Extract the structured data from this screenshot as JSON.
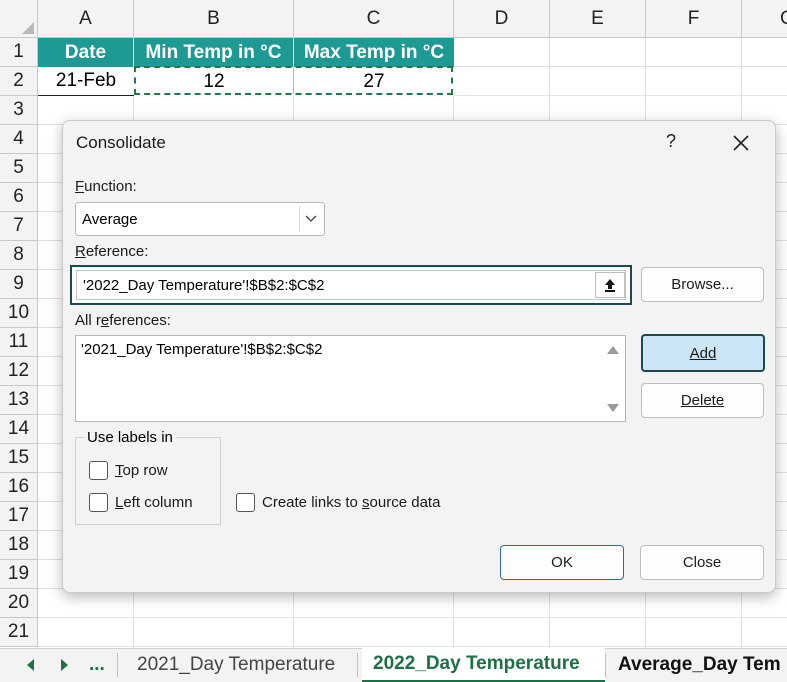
{
  "columns": [
    "A",
    "B",
    "C",
    "D",
    "E",
    "F",
    "G"
  ],
  "rows": [
    "1",
    "2",
    "3",
    "4",
    "5",
    "6",
    "7",
    "8",
    "9",
    "10",
    "11",
    "12",
    "13",
    "14",
    "15",
    "16",
    "17",
    "18",
    "19",
    "20",
    "21"
  ],
  "table": {
    "headers": [
      "Date",
      "Min Temp in °C",
      "Max Temp in °C"
    ],
    "values": [
      "21-Feb",
      "12",
      "27"
    ]
  },
  "colors": {
    "header_fill": "#1d9a94",
    "active_tab": "#1e7145",
    "marquee": "#1f7a4a"
  },
  "dialog": {
    "title": "Consolidate",
    "help": "?",
    "function_label_u": "F",
    "function_label_rest": "unction:",
    "function_value": "Average",
    "reference_label_u": "R",
    "reference_label_rest": "eference:",
    "reference_value": "'2022_Day Temperature'!$B$2:$C$2",
    "browse_label": "Browse...",
    "all_refs_label_pre": "All r",
    "all_refs_label_u": "e",
    "all_refs_label_post": "ferences:",
    "all_refs_items": [
      "'2021_Day Temperature'!$B$2:$C$2"
    ],
    "add_label": "Add",
    "delete_label": "Delete",
    "use_labels_title": "Use labels in",
    "top_row_u": "T",
    "top_row_rest": "op row",
    "left_col_u": "L",
    "left_col_rest": "eft column",
    "links_pre": "Create links to ",
    "links_u": "s",
    "links_post": "ource data",
    "ok_label": "OK",
    "close_label": "Close"
  },
  "tabs": {
    "ellipsis": "...",
    "items": [
      "2021_Day Temperature",
      "2022_Day Temperature",
      "Average_Day Tem"
    ]
  },
  "icons": [
    "nav-left-icon",
    "nav-right-icon",
    "chevron-down-icon",
    "collapse-dialog-icon",
    "close-icon",
    "scroll-up-icon",
    "scroll-down-icon"
  ]
}
